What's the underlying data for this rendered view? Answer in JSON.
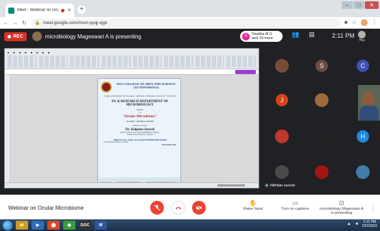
{
  "browser": {
    "tab_title": "Meet - Webinar on Ocular M",
    "url": "meet.google.com/msm-pyqj-vjgx",
    "new_tab_label": "+",
    "window_controls": [
      "–",
      "□",
      "✕"
    ]
  },
  "meet_header": {
    "rec_label": "REC",
    "presenting_text": "microbiology Mageswari A is presenting",
    "joiners_initial": "S",
    "joiners_line1": "Swetha M.S",
    "joiners_line2": "and 19 more",
    "time": "2:11 PM",
    "you_label": "You"
  },
  "presentation": {
    "college": "PSG COLLEGE OF ARTS AND SCIENCE (AUTONOMOUS)",
    "college_sub": "College with Potential for Excellence · Affiliated to Bharathiar University · Coimbatore",
    "department": "PG & RESEARCH DEPARTMENT OF MICROBIOLOGY",
    "webinar_label": "Webinar",
    "on_label": "on",
    "topic": "\"Ocular Microbiome\"",
    "date": "22.2.2021 : 2.00 PM to 3.00 PM",
    "resource_label": "Resource Person",
    "speaker": "Dr. Kalpana Suresh",
    "speaker_title": "Medical Director & Chief Ophthalmic Surgeon",
    "speaker_org": "Kalpana Eye Hospital, Chennai",
    "register_label": "Register here:",
    "register_link": "https://forms.gle/fxSPPB4AzkF5tmqi8",
    "certificate_note": "E-Certificate will be provided",
    "organising_label": "Organising team",
    "footer": [
      "Dr. T. Gopal",
      "Dr. T. Lakshmi Priya Principal",
      "Shri. Ashok Kumar Bhandari Secretary"
    ]
  },
  "participants": [
    {
      "initial": "",
      "color": "#7a4b36",
      "kind": "photo"
    },
    {
      "initial": "S",
      "color": "#6d4c41",
      "kind": "letter"
    },
    {
      "initial": "C",
      "color": "#3f51b5",
      "kind": "letter"
    },
    {
      "initial": "J",
      "color": "#d84315",
      "kind": "letter"
    },
    {
      "initial": "",
      "color": "#9c6a3b",
      "kind": "photo"
    },
    {
      "initial": "",
      "color": "#c0392b",
      "kind": "photo"
    },
    {
      "initial": "",
      "color": "#222222",
      "kind": "photo"
    },
    {
      "initial": "H",
      "color": "#1e88e5",
      "kind": "letter"
    },
    {
      "initial": "",
      "color": "#4a4a4a",
      "kind": "photo"
    },
    {
      "initial": "",
      "color": "#a31515",
      "kind": "photo"
    },
    {
      "initial": "",
      "color": "#3e7ea8",
      "kind": "photo"
    }
  ],
  "pinned_name": "Nithilan suresh",
  "controls": {
    "meeting_title": "Webinar on Ocular Microbiome",
    "raise_hand": "Raise hand",
    "captions": "Turn on captions",
    "presenter_line1": "microbiology Mageswari A",
    "presenter_line2": "is presenting",
    "colors": {
      "danger": "#ea4335"
    }
  },
  "taskbar": {
    "apps": [
      "📁",
      "▶",
      "⬤",
      "◉",
      "DOC",
      "W"
    ],
    "time": "2:11 PM",
    "date": "2/22/2021"
  }
}
